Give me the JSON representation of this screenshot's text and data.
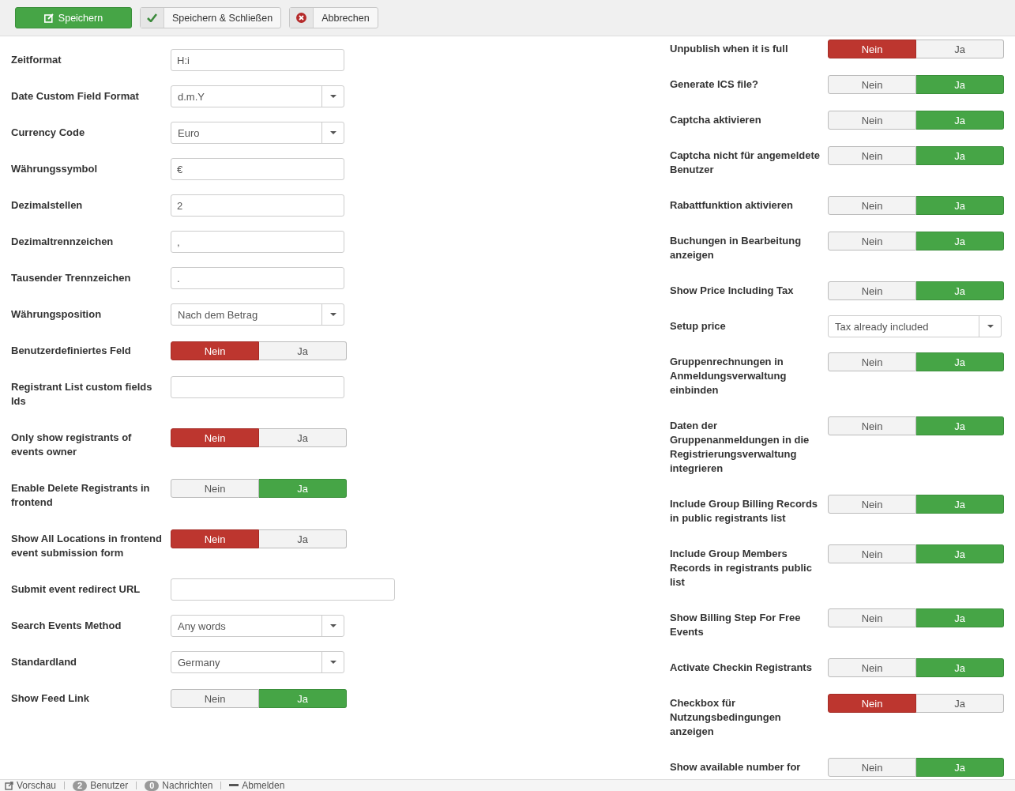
{
  "toolbar": [
    {
      "label": "Speichern",
      "kind": "primary"
    },
    {
      "label": "Speichern & Schließen",
      "kind": "check"
    },
    {
      "label": "Abbrechen",
      "kind": "cancel"
    }
  ],
  "left_fields": [
    {
      "label": "Zeitformat",
      "kind": "text",
      "value": "H:i"
    },
    {
      "label": "Date Custom Field Format",
      "kind": "select",
      "value": "d.m.Y"
    },
    {
      "label": "Currency Code",
      "kind": "select",
      "value": "Euro"
    },
    {
      "label": "Währungssymbol",
      "kind": "text",
      "value": "€"
    },
    {
      "label": "Dezimalstellen",
      "kind": "text",
      "value": "2"
    },
    {
      "label": "Dezimaltrennzeichen",
      "kind": "text",
      "value": ","
    },
    {
      "label": "Tausender Trennzeichen",
      "kind": "text",
      "value": "."
    },
    {
      "label": "Währungsposition",
      "kind": "select",
      "value": "Nach dem Betrag"
    },
    {
      "label": "Benutzerdefiniertes Feld",
      "kind": "toggle",
      "options": [
        {
          "label": "Nein",
          "selected": true
        },
        {
          "label": "Ja",
          "selected": false
        }
      ]
    },
    {
      "label": "Registrant List custom fields Ids",
      "kind": "text"
    },
    {
      "label": "Only show registrants of events owner",
      "kind": "toggle",
      "options": [
        {
          "label": "Nein",
          "selected": true
        },
        {
          "label": "Ja",
          "selected": false
        }
      ]
    },
    {
      "label": "Enable Delete Registrants in frontend",
      "kind": "toggle",
      "options": [
        {
          "label": "Nein",
          "selected": false
        },
        {
          "label": "Ja",
          "selected": true
        }
      ]
    },
    {
      "label": "Show All Locations in frontend event submission form",
      "kind": "toggle",
      "options": [
        {
          "label": "Nein",
          "selected": true
        },
        {
          "label": "Ja",
          "selected": false
        }
      ]
    },
    {
      "label": "Submit event redirect URL",
      "kind": "text",
      "wide": true
    },
    {
      "label": "Search Events Method",
      "kind": "select",
      "value": "Any words"
    },
    {
      "label": "Standardland",
      "kind": "select",
      "value": "Germany"
    },
    {
      "label": "Show Feed Link",
      "kind": "toggle",
      "options": [
        {
          "label": "Nein",
          "selected": false
        },
        {
          "label": "Ja",
          "selected": true
        }
      ]
    }
  ],
  "right_fields": [
    {
      "label": "Unpublish when it is full",
      "kind": "toggle",
      "options": [
        {
          "label": "Nein",
          "selected": true
        },
        {
          "label": "Ja",
          "selected": false
        }
      ]
    },
    {
      "label": "Generate ICS file?",
      "kind": "toggle",
      "options": [
        {
          "label": "Nein",
          "selected": false
        },
        {
          "label": "Ja",
          "selected": true
        }
      ]
    },
    {
      "label": "Captcha aktivieren",
      "kind": "toggle",
      "options": [
        {
          "label": "Nein",
          "selected": false
        },
        {
          "label": "Ja",
          "selected": true
        }
      ]
    },
    {
      "label": "Captcha nicht für angemeldete Benutzer",
      "kind": "toggle",
      "options": [
        {
          "label": "Nein",
          "selected": false
        },
        {
          "label": "Ja",
          "selected": true
        }
      ]
    },
    {
      "label": "Rabattfunktion aktivieren",
      "kind": "toggle",
      "options": [
        {
          "label": "Nein",
          "selected": false
        },
        {
          "label": "Ja",
          "selected": true
        }
      ]
    },
    {
      "label": "Buchungen in Bearbeitung anzeigen",
      "kind": "toggle",
      "options": [
        {
          "label": "Nein",
          "selected": false
        },
        {
          "label": "Ja",
          "selected": true
        }
      ]
    },
    {
      "label": "Show Price Including Tax",
      "kind": "toggle",
      "options": [
        {
          "label": "Nein",
          "selected": false
        },
        {
          "label": "Ja",
          "selected": true
        }
      ]
    },
    {
      "label": "Setup price",
      "kind": "select",
      "value": "Tax already included"
    },
    {
      "label": "Gruppenrechnungen in Anmeldungsverwaltung einbinden",
      "kind": "toggle",
      "options": [
        {
          "label": "Nein",
          "selected": false
        },
        {
          "label": "Ja",
          "selected": true
        }
      ]
    },
    {
      "label": "Daten der Gruppenanmeldungen in die Registrierungsverwaltung integrieren",
      "kind": "toggle",
      "options": [
        {
          "label": "Nein",
          "selected": false
        },
        {
          "label": "Ja",
          "selected": true
        }
      ]
    },
    {
      "label": "Include Group Billing Records in public registrants list",
      "kind": "toggle",
      "options": [
        {
          "label": "Nein",
          "selected": false
        },
        {
          "label": "Ja",
          "selected": true
        }
      ]
    },
    {
      "label": "Include Group Members Records in registrants public list",
      "kind": "toggle",
      "options": [
        {
          "label": "Nein",
          "selected": false
        },
        {
          "label": "Ja",
          "selected": true
        }
      ]
    },
    {
      "label": "Show Billing Step For Free Events",
      "kind": "toggle",
      "options": [
        {
          "label": "Nein",
          "selected": false
        },
        {
          "label": "Ja",
          "selected": true
        }
      ]
    },
    {
      "label": "Activate Checkin Registrants",
      "kind": "toggle",
      "options": [
        {
          "label": "Nein",
          "selected": false
        },
        {
          "label": "Ja",
          "selected": true
        }
      ]
    },
    {
      "label": "Checkbox für Nutzungsbedingungen anzeigen",
      "kind": "toggle",
      "options": [
        {
          "label": "Nein",
          "selected": true
        },
        {
          "label": "Ja",
          "selected": false
        }
      ]
    },
    {
      "label": "Show available number for",
      "kind": "toggle",
      "options": [
        {
          "label": "Nein",
          "selected": false
        },
        {
          "label": "Ja",
          "selected": true
        }
      ]
    }
  ],
  "status_bar": [
    {
      "label": "Vorschau",
      "kind": "preview"
    },
    {
      "label": "Benutzer",
      "kind": "count",
      "count": "2"
    },
    {
      "label": "Nachrichten",
      "kind": "count",
      "count": "0"
    },
    {
      "label": "Abmelden",
      "kind": "logout"
    }
  ]
}
